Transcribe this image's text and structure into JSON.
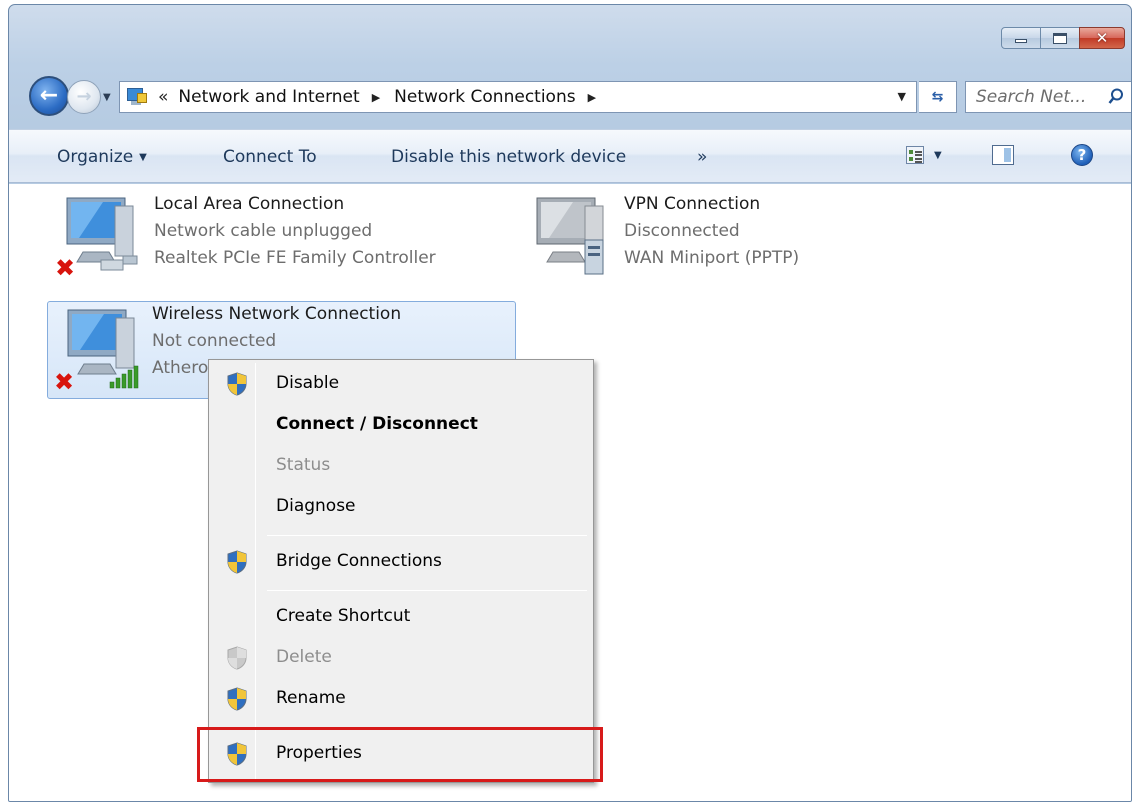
{
  "window": {
    "caption_buttons": [
      "minimize",
      "maximize",
      "close"
    ]
  },
  "nav": {
    "breadcrumb_overflow": "«",
    "breadcrumbs": [
      "Network and Internet",
      "Network Connections"
    ],
    "search_placeholder": "Search Net...",
    "icons": [
      "back-arrow-icon",
      "forward-arrow-icon",
      "network-folder-icon",
      "refresh-icon",
      "search-icon"
    ]
  },
  "toolbar": {
    "organize": "Organize",
    "connect_to": "Connect To",
    "disable_device": "Disable this network device",
    "more": "»",
    "icons": [
      "change-view-icon",
      "preview-pane-icon",
      "help-icon"
    ]
  },
  "connections": [
    {
      "name": "Local Area Connection",
      "status": "Network cable unplugged",
      "device": "Realtek PCIe FE Family Controller",
      "status_icon": "red-x-icon"
    },
    {
      "name": "VPN Connection",
      "status": "Disconnected",
      "device": "WAN Miniport (PPTP)"
    },
    {
      "name": "Wireless Network Connection",
      "status": "Not connected",
      "device": "Athero",
      "status_icon": "red-x-icon",
      "selected": true
    }
  ],
  "context_menu": {
    "items": [
      {
        "label": "Disable",
        "shield": true
      },
      {
        "label": "Connect / Disconnect",
        "bold": true
      },
      {
        "label": "Status",
        "disabled": true
      },
      {
        "label": "Diagnose"
      },
      {
        "label": "Bridge Connections",
        "shield": true
      },
      {
        "label": "Create Shortcut"
      },
      {
        "label": "Delete",
        "disabled": true,
        "shield": true
      },
      {
        "label": "Rename",
        "shield": true
      },
      {
        "label": "Properties",
        "shield": true,
        "highlighted": true
      }
    ]
  },
  "colors": {
    "highlight_box": "#d71a1a",
    "selection": "#d6e6f8",
    "command_text": "#1e395b",
    "secondary_text": "#6d6d6d"
  }
}
